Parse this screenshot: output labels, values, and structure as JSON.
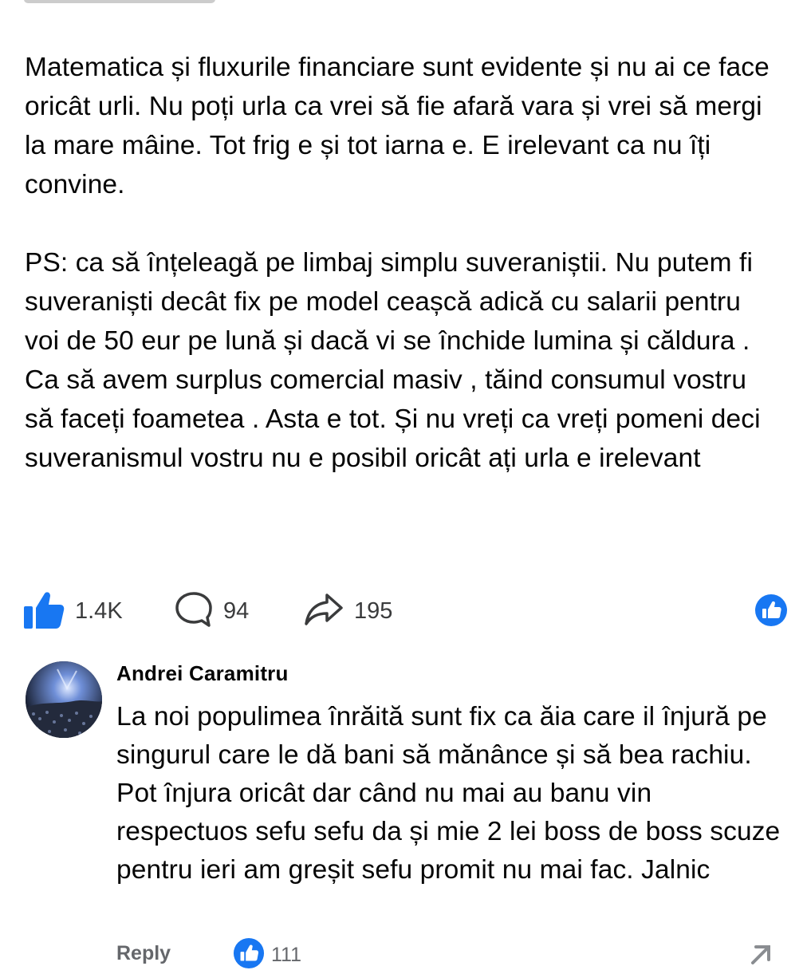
{
  "post": {
    "paragraphs": [
      "Matematica și fluxurile financiare sunt evidente și nu ai ce face oricât urli. Nu poți urla ca vrei să fie afară vara și vrei să mergi la mare mâine. Tot frig e și tot iarna e. E irelevant ca nu îți convine.",
      "PS: ca să înțeleagă pe limbaj simplu suveraniștii. Nu putem fi suveraniști decât fix pe model ceașcă adică cu salarii pentru voi de 50 eur pe lună și dacă vi se închide lumina și căldura . Ca să avem surplus comercial masiv , tăind consumul vostru să faceți foametea . Asta e tot. Și nu vreți ca vreți pomeni deci suveranismul vostru nu e posibil oricât ați urla e irelevant"
    ],
    "actions": {
      "like_count": "1.4K",
      "comment_count": "94",
      "share_count": "195"
    }
  },
  "comment": {
    "author": "Andrei Caramitru",
    "text": "La noi populimea înrăită sunt fix ca ăia care il înjură pe singurul care le dă bani să mănânce și să bea rachiu. Pot înjura oricât dar când nu mai au banu vin respectuos sefu sefu da și mie 2 lei boss de boss scuze pentru ieri am greșit sefu promit nu mai fac. Jalnic",
    "reply_label": "Reply",
    "reaction_count": "111"
  },
  "icons": {
    "like": "thumbs-up-icon",
    "comment": "speech-bubble-icon",
    "share": "share-arrow-icon",
    "like_badge": "like-reaction-badge-icon"
  },
  "colors": {
    "accent": "#1877f2",
    "text": "#050505",
    "muted": "#65676b",
    "icon": "#3a3b3c"
  }
}
